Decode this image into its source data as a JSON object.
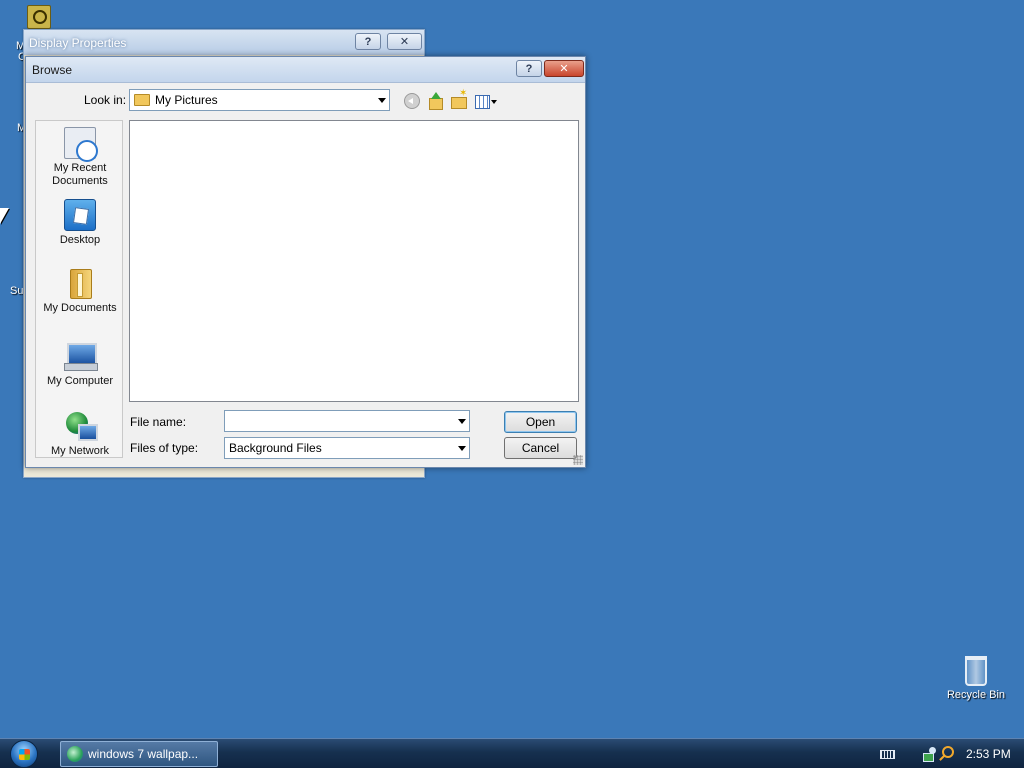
{
  "desktop": {
    "partial_labels": [
      "M",
      "C",
      "M",
      "Su"
    ],
    "recycle_bin_label": "Recycle Bin"
  },
  "display_properties": {
    "title": "Display Properties",
    "help_glyph": "?",
    "close_glyph": "✕"
  },
  "browse": {
    "title": "Browse",
    "help_glyph": "?",
    "close_glyph": "✕",
    "look_in_label": "Look in:",
    "look_in_value": "My Pictures",
    "places": [
      {
        "label_line1": "My Recent",
        "label_line2": "Documents",
        "icon": "recent-documents-icon"
      },
      {
        "label_line1": "Desktop",
        "label_line2": "",
        "icon": "desktop-icon"
      },
      {
        "label_line1": "My Documents",
        "label_line2": "",
        "icon": "my-documents-icon"
      },
      {
        "label_line1": "My Computer",
        "label_line2": "",
        "icon": "my-computer-icon"
      },
      {
        "label_line1": "My Network",
        "label_line2": "",
        "icon": "my-network-icon"
      }
    ],
    "file_name_label": "File name:",
    "file_name_value": "",
    "files_of_type_label": "Files of type:",
    "files_of_type_value": "Background Files",
    "open_label": "Open",
    "cancel_label": "Cancel"
  },
  "taskbar": {
    "task_label": "windows 7 wallpap...",
    "clock": "2:53 PM"
  },
  "colors": {
    "desktop_background": "#3a78b9",
    "taskbar": "#16304f"
  }
}
